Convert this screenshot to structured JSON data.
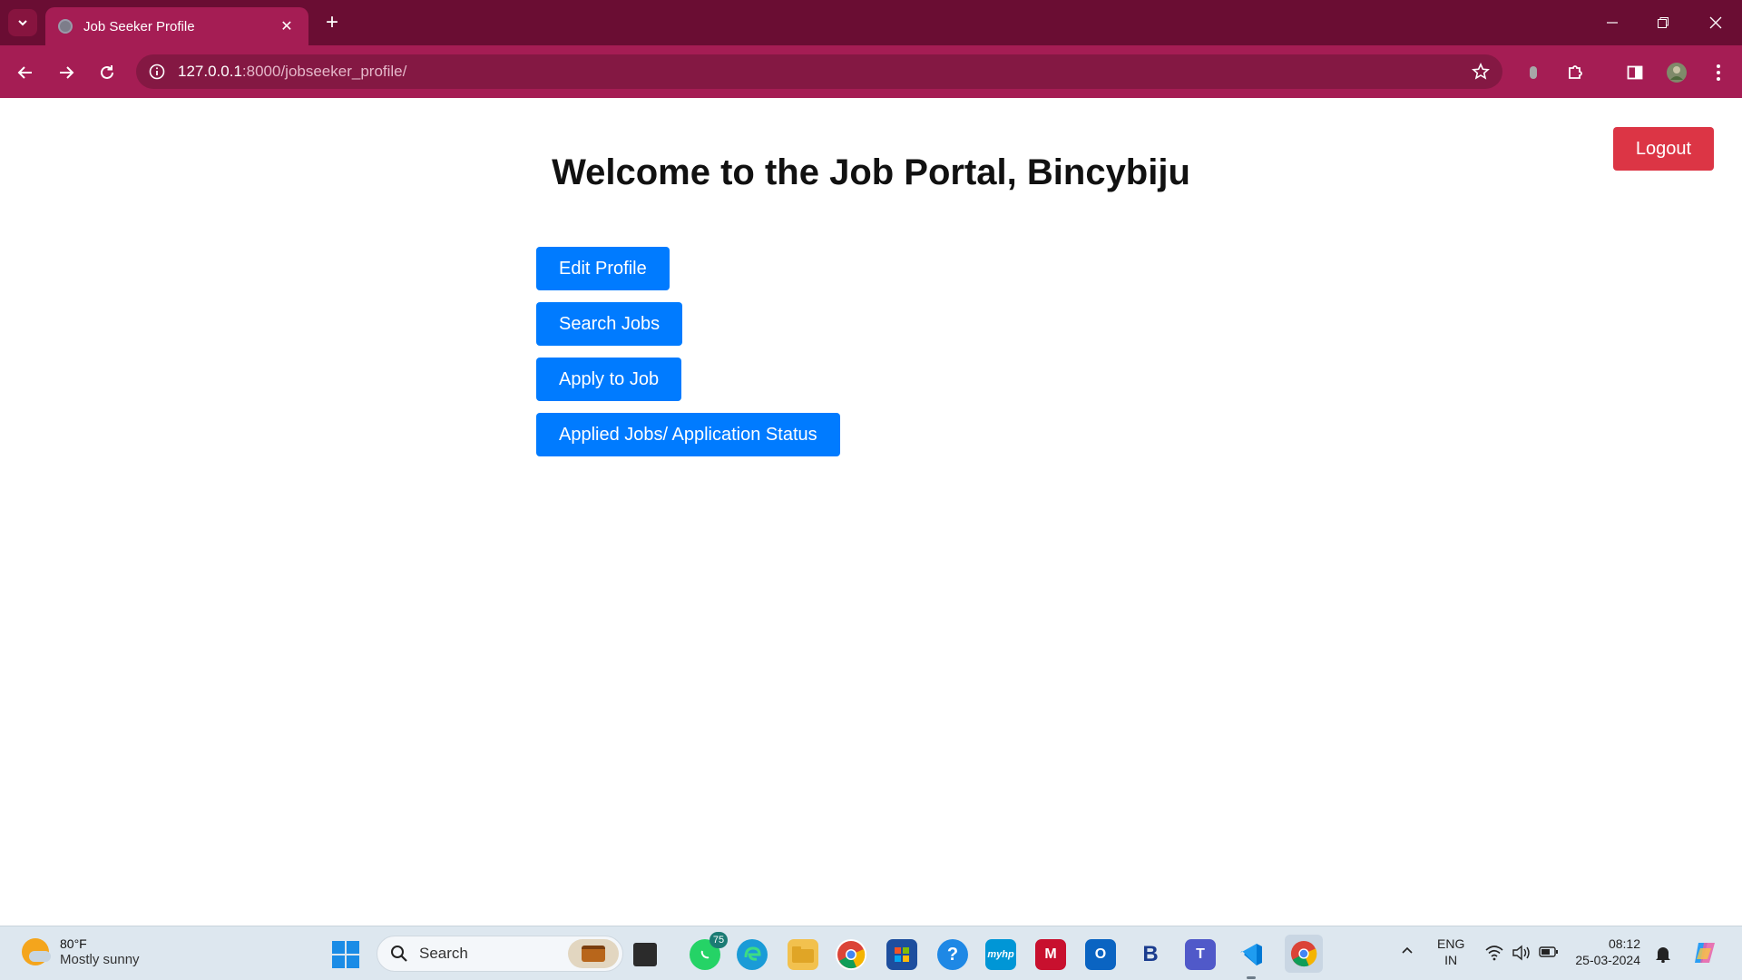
{
  "browser": {
    "tab_title": "Job Seeker Profile",
    "url_host": "127.0.0.1",
    "url_rest": ":8000/jobseeker_profile/"
  },
  "page": {
    "welcome": "Welcome to the Job Portal, Bincybiju",
    "logout_label": "Logout",
    "actions": [
      {
        "label": "Edit Profile"
      },
      {
        "label": "Search Jobs"
      },
      {
        "label": "Apply to Job"
      },
      {
        "label": "Applied Jobs/ Application Status"
      }
    ]
  },
  "taskbar": {
    "temperature": "80°F",
    "condition": "Mostly sunny",
    "search_placeholder": "Search",
    "whatsapp_badge": "75",
    "lang_top": "ENG",
    "lang_bottom": "IN",
    "time": "08:12",
    "date": "25-03-2024"
  },
  "colors": {
    "logout": "#dc3545",
    "action": "#007bff",
    "chrome_dark": "#6a0d33",
    "chrome_light": "#a51d54"
  }
}
